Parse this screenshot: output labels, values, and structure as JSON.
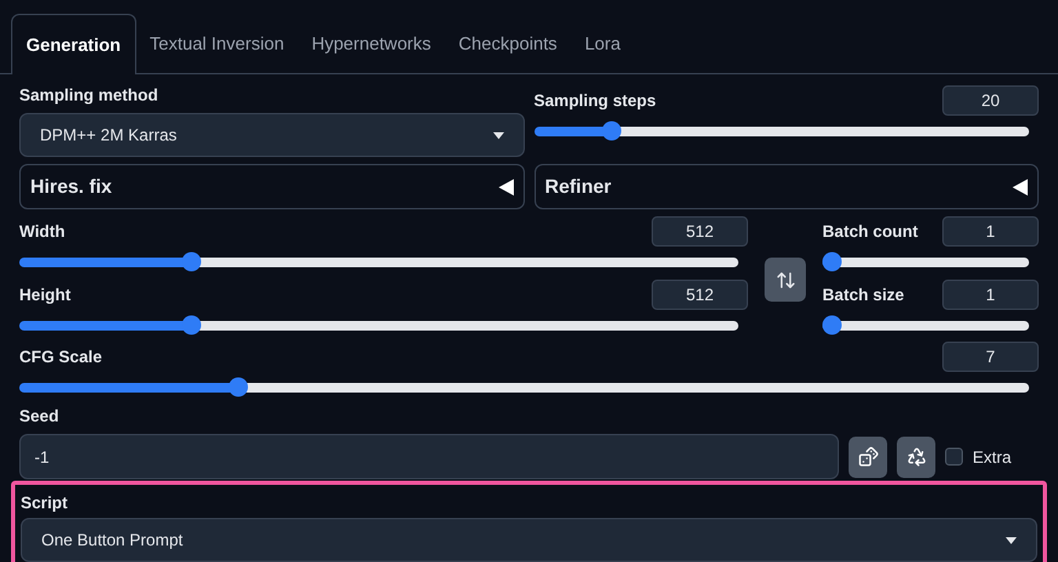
{
  "tabs": [
    {
      "label": "Generation",
      "selected": true
    },
    {
      "label": "Textual Inversion",
      "selected": false
    },
    {
      "label": "Hypernetworks",
      "selected": false
    },
    {
      "label": "Checkpoints",
      "selected": false
    },
    {
      "label": "Lora",
      "selected": false
    }
  ],
  "sampling_method": {
    "label": "Sampling method",
    "value": "DPM++ 2M Karras"
  },
  "sampling_steps": {
    "label": "Sampling steps",
    "value": "20",
    "level": 0.14
  },
  "accordions": [
    {
      "label": "Hires. fix",
      "expanded": false
    },
    {
      "label": "Refiner",
      "expanded": false
    }
  ],
  "width": {
    "label": "Width",
    "value": "512",
    "level": 0.23
  },
  "height": {
    "label": "Height",
    "value": "512",
    "level": 0.23
  },
  "batch_count": {
    "label": "Batch count",
    "value": "1",
    "level": 0
  },
  "batch_size": {
    "label": "Batch size",
    "value": "1",
    "level": 0
  },
  "cfg_scale": {
    "label": "CFG Scale",
    "value": "7",
    "level": 0.21
  },
  "seed": {
    "label": "Seed",
    "value": "-1",
    "extra": {
      "label": "Extra",
      "checked": false
    }
  },
  "script": {
    "label": "Script",
    "value": "One Button Prompt",
    "highlighted": true
  }
}
